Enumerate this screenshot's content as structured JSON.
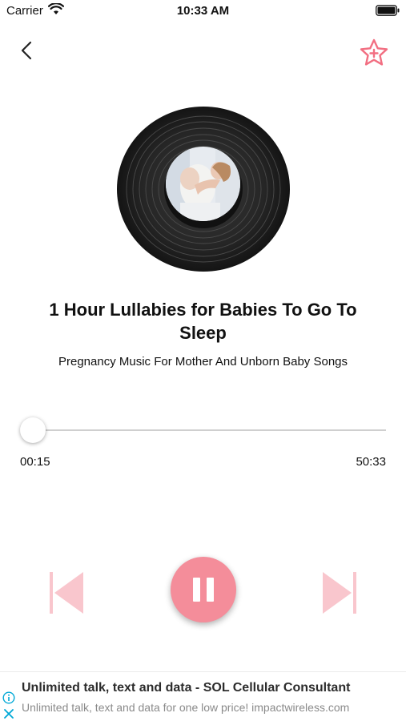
{
  "status_bar": {
    "carrier": "Carrier",
    "time": "10:33 AM"
  },
  "nav": {
    "back_icon": "chevron-left-icon",
    "favorite_icon": "star-plus-icon"
  },
  "player": {
    "title": "1 Hour Lullabies for Babies To Go To Sleep",
    "subtitle": "Pregnancy Music For Mother And Unborn Baby Songs",
    "elapsed": "00:15",
    "duration": "50:33",
    "progress": 0.004,
    "state": "playing"
  },
  "controls": {
    "prev_icon": "skip-previous-icon",
    "pause_icon": "pause-icon",
    "next_icon": "skip-next-icon"
  },
  "ad": {
    "title": "Unlimited talk, text and data - SOL Cellular Consultant",
    "description": "Unlimited talk, text and data for one low price! impactwireless.com"
  },
  "colors": {
    "accent": "#f48d9a",
    "accent_light": "#f9c6cd",
    "ad_icon": "#00a8d6"
  }
}
